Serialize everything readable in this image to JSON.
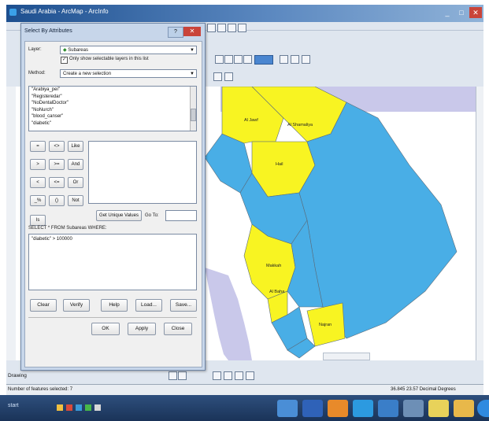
{
  "app": {
    "title": "Saudi Arabia - ArcMap - ArcInfo",
    "status_left": "Number of features selected: 7",
    "status_right": "36.845  23.57 Decimal Degrees",
    "bottom_menu": "Drawing"
  },
  "dialog": {
    "title": "Select By Attributes",
    "help_label": "?",
    "close_label": "✕",
    "layer_label": "Layer:",
    "layer_value": "Subareas",
    "only_selectable_label": "Only show selectable layers in this list",
    "method_label": "Method:",
    "method_value": "Create a new selection",
    "fields": [
      "\"Arabiya_pei\"",
      "\"Registeredar\"",
      "\"NoDentalDoctor\"",
      "\"NoNurch\"",
      "\"blood_canser\"",
      "\"diabetic\""
    ],
    "operators": [
      "=",
      "<>",
      "Like",
      ">",
      ">=",
      "And",
      "<",
      "<=",
      "Or",
      "_%",
      "()",
      "Not",
      "Is"
    ],
    "get_unique_label": "Get Unique Values",
    "goto_label": "Go To:",
    "query_prefix": "SELECT * FROM Subareas WHERE:",
    "query_text": "\"diabetic\" > 100000",
    "buttons": {
      "clear": "Clear",
      "verify": "Verify",
      "help": "Help",
      "load": "Load...",
      "save": "Save...",
      "ok": "OK",
      "apply": "Apply",
      "close": "Close"
    }
  },
  "map": {
    "labels": {
      "al_jawf": "Al Jawf",
      "al_shamaliya": "Al Shamaliya",
      "hail": "Hail",
      "makkah": "Makkah",
      "al_baha": "Al Baha",
      "najran": "Najran"
    },
    "colors": {
      "selected": "#f8f422",
      "unselected": "#49aee6",
      "water": "#c9c8ea",
      "borders": "#5a6b7a"
    }
  },
  "taskbar": {
    "start_label": "start",
    "apps": [
      "explorer-icon",
      "chrome-icon",
      "media-icon",
      "skype-icon",
      "arcgis-icon",
      "network-icon",
      "notes-icon",
      "folder-icon",
      "start-orb"
    ]
  }
}
